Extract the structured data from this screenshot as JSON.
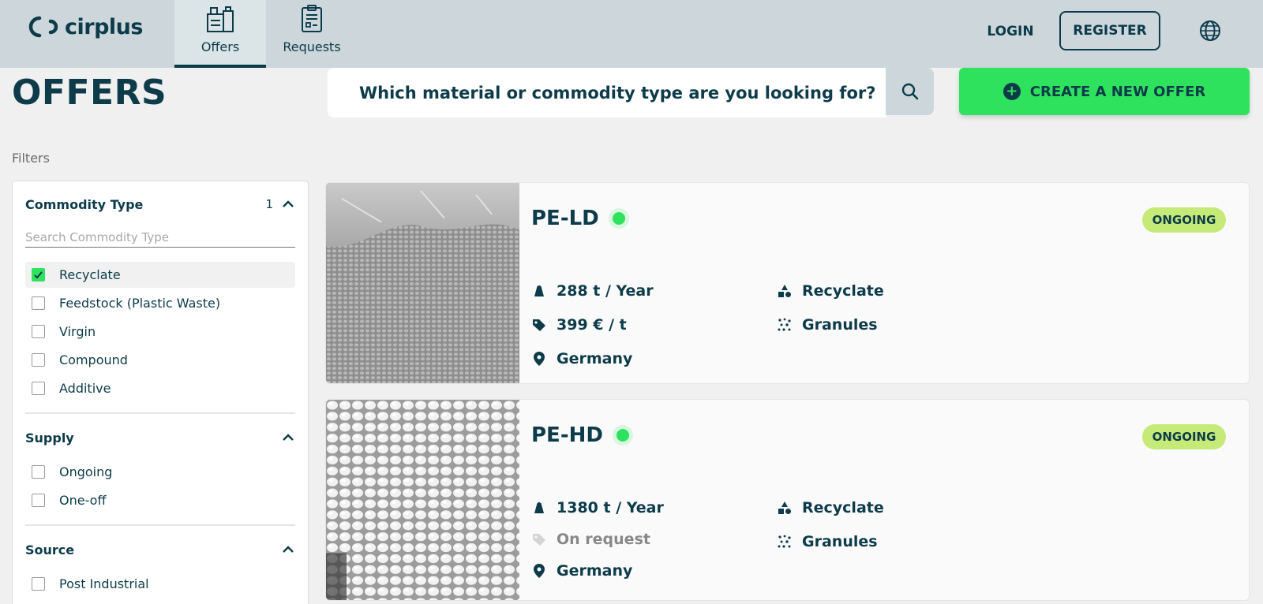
{
  "header": {
    "logo_text": "cirplus",
    "tabs": [
      {
        "label": "Offers",
        "icon": "building-bag-icon",
        "active": true
      },
      {
        "label": "Requests",
        "icon": "clipboard-icon",
        "active": false
      }
    ],
    "login_label": "LOGIN",
    "register_label": "REGISTER",
    "language_icon": "globe-icon"
  },
  "page": {
    "title": "OFFERS",
    "search_placeholder": "Which material or commodity type are you looking for?",
    "create_label": "CREATE A NEW OFFER",
    "filters_label": "Filters"
  },
  "filters": {
    "commodity": {
      "title": "Commodity Type",
      "count": "1",
      "search_placeholder": "Search Commodity Type",
      "options": [
        {
          "label": "Recyclate",
          "checked": true
        },
        {
          "label": "Feedstock (Plastic Waste)",
          "checked": false
        },
        {
          "label": "Virgin",
          "checked": false
        },
        {
          "label": "Compound",
          "checked": false
        },
        {
          "label": "Additive",
          "checked": false
        }
      ]
    },
    "supply": {
      "title": "Supply",
      "options": [
        {
          "label": "Ongoing",
          "checked": false
        },
        {
          "label": "One-off",
          "checked": false
        }
      ]
    },
    "source": {
      "title": "Source",
      "options": [
        {
          "label": "Post Industrial",
          "checked": false
        }
      ]
    }
  },
  "offers": [
    {
      "title": "PE-LD",
      "status": "ONGOING",
      "volume": "288 t / Year",
      "price": "399 € / t",
      "location": "Germany",
      "type": "Recyclate",
      "form": "Granules"
    },
    {
      "title": "PE-HD",
      "status": "ONGOING",
      "volume": "1380 t / Year",
      "price": "On request",
      "location": "Germany",
      "type": "Recyclate",
      "form": "Granules"
    }
  ],
  "colors": {
    "brand_dark": "#0d3b4a",
    "accent_green": "#2fe25e",
    "badge_green": "#c5ea78",
    "nav_bg": "#ccd6db"
  }
}
